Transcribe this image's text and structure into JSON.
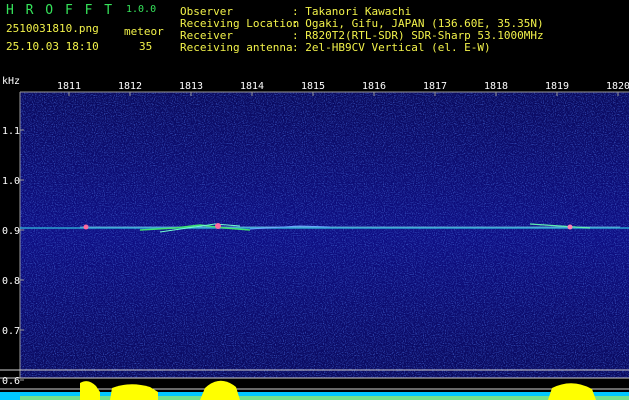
{
  "header": {
    "app_name": "H R O F F T",
    "version": "1.0.0",
    "filename": "2510031810.png",
    "datetime": "25.10.03 18:10",
    "meteor_label": "meteor",
    "meteor_count": "35"
  },
  "info": {
    "observer_label": "Observer",
    "observer_value": ": Takanori Kawachi",
    "location_label": "Receiving Location",
    "location_value": ": Ogaki, Gifu, JAPAN (136.60E, 35.35N)",
    "receiver_label": "Receiver",
    "receiver_value": ": R820T2(RTL-SDR) SDR-Sharp 53.1000MHz",
    "antenna_label": "Receiving antenna",
    "antenna_value": ": 2el-HB9CV Vertical (el. E-W)"
  },
  "axis": {
    "unit": "kHz",
    "time_ticks": [
      "1811",
      "1812",
      "1813",
      "1814",
      "1815",
      "1816",
      "1817",
      "1818",
      "1819",
      "1820"
    ],
    "freq_ticks": [
      "1.1",
      "1.0",
      "0.9",
      "0.8",
      "0.7",
      "0.6"
    ]
  },
  "colors": {
    "background": "#000000",
    "spectrogram": "#0c0c7a",
    "signal": "#7ff0ff",
    "level_bar": "#ffff00",
    "level_base": "#00c8ff"
  }
}
